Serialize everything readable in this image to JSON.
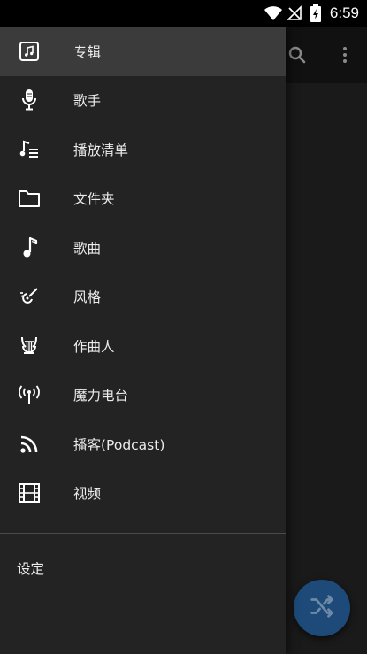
{
  "status_bar": {
    "time": "6:59"
  },
  "drawer": {
    "items": [
      {
        "label": "专辑",
        "icon": "album-icon",
        "active": true
      },
      {
        "label": "歌手",
        "icon": "microphone-icon"
      },
      {
        "label": "播放清单",
        "icon": "playlist-icon"
      },
      {
        "label": "文件夹",
        "icon": "folder-icon"
      },
      {
        "label": "歌曲",
        "icon": "music-note-icon"
      },
      {
        "label": "风格",
        "icon": "genre-guitar-icon"
      },
      {
        "label": "作曲人",
        "icon": "lyre-icon"
      },
      {
        "label": "魔力电台",
        "icon": "radio-antenna-icon"
      },
      {
        "label": "播客(Podcast)",
        "icon": "rss-icon"
      },
      {
        "label": "视频",
        "icon": "film-icon"
      }
    ],
    "settings_label": "设定"
  },
  "colors": {
    "fab": "#1d4a78",
    "drawer": "#232323",
    "active_item": "#3b3b3b"
  }
}
